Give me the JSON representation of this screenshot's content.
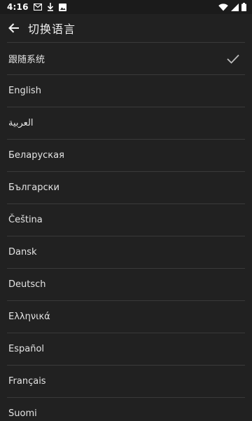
{
  "status_bar": {
    "time": "4:16",
    "icons": [
      "gmail-icon",
      "download-icon",
      "image-icon",
      "wifi-icon",
      "signal-icon",
      "battery-icon"
    ]
  },
  "toolbar": {
    "title": "切换语言",
    "back_icon": "arrow-back-icon"
  },
  "languages": [
    {
      "label": "跟随系统",
      "selected": true
    },
    {
      "label": "English",
      "selected": false
    },
    {
      "label": "العربية",
      "selected": false
    },
    {
      "label": "Беларуская",
      "selected": false
    },
    {
      "label": "Български",
      "selected": false
    },
    {
      "label": "Čeština",
      "selected": false
    },
    {
      "label": "Dansk",
      "selected": false
    },
    {
      "label": "Deutsch",
      "selected": false
    },
    {
      "label": "Ελληνικά",
      "selected": false
    },
    {
      "label": "Español",
      "selected": false
    },
    {
      "label": "Français",
      "selected": false
    },
    {
      "label": "Suomi",
      "selected": false
    }
  ],
  "colors": {
    "background": "#212121",
    "divider": "#3a3a3a",
    "text": "#e4e4e4",
    "check": "#bdbdbd"
  }
}
